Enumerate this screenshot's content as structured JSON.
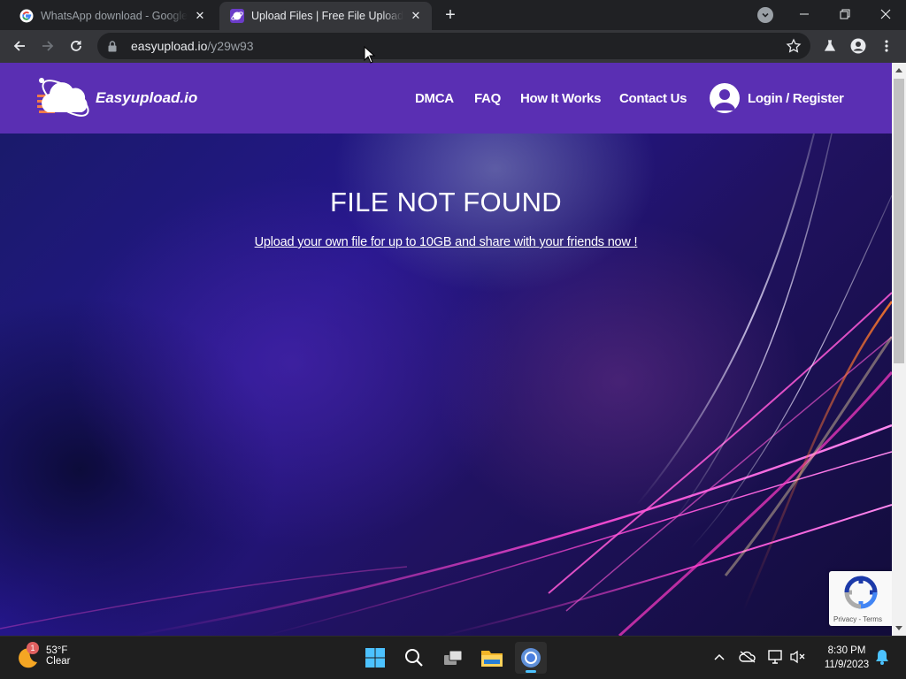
{
  "browser": {
    "tabs": [
      {
        "title": "WhatsApp download - Google Se",
        "favicon": "google-g-icon",
        "active": false
      },
      {
        "title": "Upload Files | Free File Upload an",
        "favicon": "easyupload-favicon",
        "active": true
      }
    ],
    "url_host": "easyupload.io",
    "url_path": "/y29w93"
  },
  "site": {
    "logo_text": "Easyupload.io",
    "nav": [
      {
        "label": "DMCA"
      },
      {
        "label": "FAQ"
      },
      {
        "label": "How It Works"
      },
      {
        "label": "Contact Us"
      }
    ],
    "login_label": "Login / Register",
    "brand_color": "#5a2fb3"
  },
  "hero": {
    "title": "FILE NOT FOUND",
    "link_text": "Upload your own file for up to 10GB and share with your friends now !"
  },
  "recaptcha": {
    "terms": "Privacy - Terms"
  },
  "taskbar": {
    "weather_temp": "53°F",
    "weather_desc": "Clear",
    "weather_badge": "1",
    "time": "8:30 PM",
    "date": "11/9/2023"
  }
}
